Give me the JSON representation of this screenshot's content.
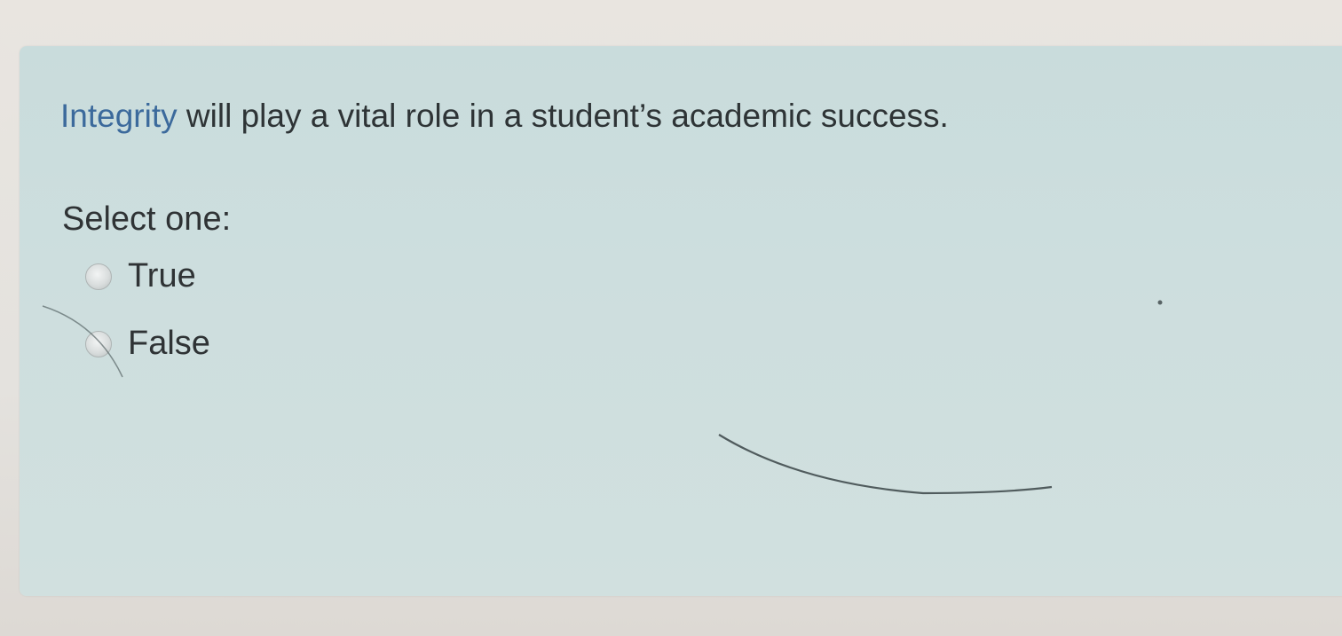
{
  "question": {
    "link_text": "Integrity",
    "rest_text": " will play a vital role in a student’s academic success."
  },
  "prompt": "Select one:",
  "answers": [
    {
      "label": "True",
      "selected": false
    },
    {
      "label": "False",
      "selected": false
    }
  ]
}
